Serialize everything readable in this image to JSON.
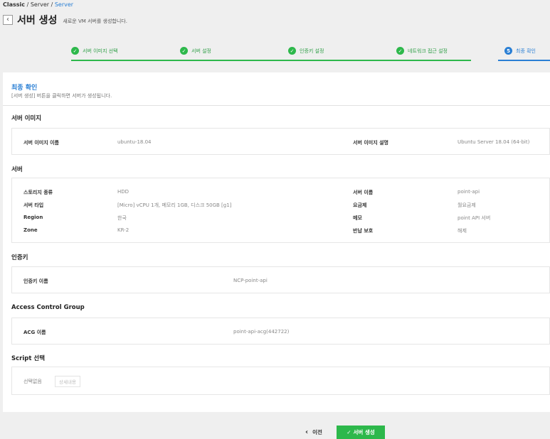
{
  "breadcrumb": {
    "item1": "Classic",
    "sep1": " / ",
    "item2": "Server",
    "sep2": " / ",
    "item3": "Server"
  },
  "header": {
    "back_icon": "chevron-left-icon",
    "title": "서버 생성",
    "description": "새로운 VM 서버를 생성합니다."
  },
  "steps": [
    {
      "label": "서버 이미지 선택",
      "icon": "✓",
      "state": "done"
    },
    {
      "label": "서버 설정",
      "icon": "✓",
      "state": "done"
    },
    {
      "label": "인증키 설정",
      "icon": "✓",
      "state": "done"
    },
    {
      "label": "네트워크 접근 설정",
      "icon": "✓",
      "state": "done"
    },
    {
      "label": "최종 확인",
      "icon": "5",
      "state": "active"
    }
  ],
  "final": {
    "title": "최종 확인",
    "description": "[서버 생성] 버튼을 클릭하면 서버가 생성됩니다."
  },
  "server_image": {
    "title": "서버 이미지",
    "name_label": "서버 이미지 이름",
    "name_value": "ubuntu-18.04",
    "desc_label": "서버 이미지 설명",
    "desc_value": "Ubuntu Server 18.04 (64-bit)"
  },
  "server": {
    "title": "서버",
    "storage_label": "스토리지 종류",
    "storage_value": "HDD",
    "type_label": "서버 타입",
    "type_value": "[Micro] vCPU 1개, 메모리 1GB, 디스크 50GB [g1]",
    "region_label": "Region",
    "region_value": "한국",
    "zone_label": "Zone",
    "zone_value": "KR-2",
    "name_label": "서버 이름",
    "name_value": "point-api",
    "fee_label": "요금제",
    "fee_value": "월요금제",
    "memo_label": "메모",
    "memo_value": "point API 서버",
    "return_label": "반납 보호",
    "return_value": "해제"
  },
  "auth_key": {
    "title": "인증키",
    "label": "인증키 이름",
    "value": "NCP-point-api"
  },
  "acg": {
    "title": "Access Control Group",
    "label": "ACG 이름",
    "value": "point-api-acg(442722)"
  },
  "script": {
    "title": "Script 선택",
    "none": "선택없음",
    "detail_button": "상세내용"
  },
  "footer": {
    "prev_label": "이전",
    "prev_icon": "chevron-left-icon",
    "create_label": "서버 생성",
    "create_icon": "check-icon"
  },
  "colors": {
    "accent_green": "#2db84b",
    "accent_blue": "#2a7fd4"
  }
}
